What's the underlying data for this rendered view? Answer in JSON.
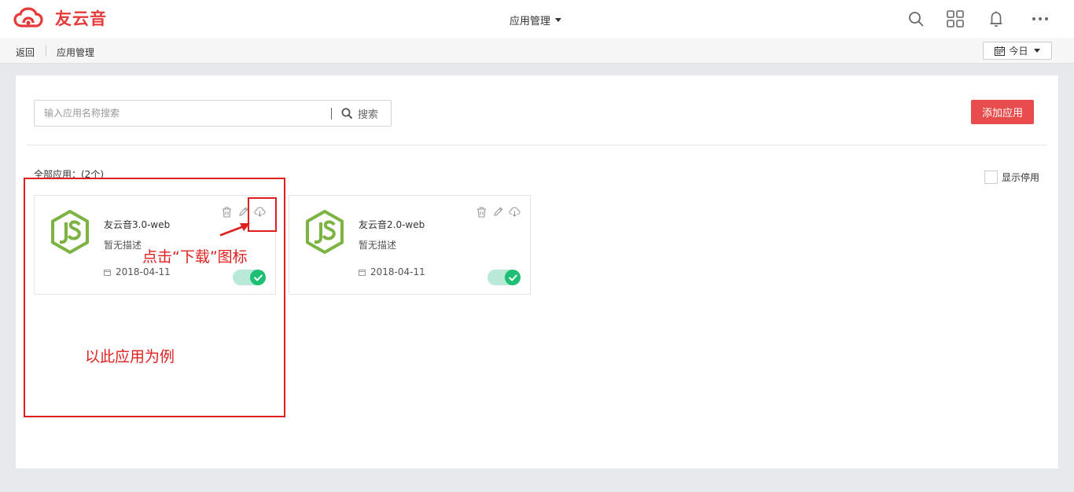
{
  "header": {
    "brand": "友云音",
    "app_switcher": "应用管理",
    "icons": [
      "search-icon",
      "apps-grid-icon",
      "bell-icon",
      "more-icon"
    ]
  },
  "subbar": {
    "back": "返回",
    "title": "应用管理",
    "date_filter": "今日"
  },
  "toolbar": {
    "search_placeholder": "输入应用名称搜索",
    "search_button": "搜索",
    "add_button": "添加应用"
  },
  "list": {
    "count_label": "全部应用：(2个)",
    "show_disabled": "显示停用",
    "apps": [
      {
        "name": "友云音3.0-web",
        "description": "暂无描述",
        "date": "2018-04-11",
        "enabled": true
      },
      {
        "name": "友云音2.0-web",
        "description": "暂无描述",
        "date": "2018-04-11",
        "enabled": true
      }
    ]
  },
  "annotations": {
    "click_download": "点击“下载”图标",
    "example_app": "以此应用为例"
  },
  "colors": {
    "brand_red": "#e63a3a",
    "add_button": "#e84c4c",
    "toggle_on": "#1ebf75",
    "annotation": "#e02020",
    "node_green": "#7cb342"
  }
}
